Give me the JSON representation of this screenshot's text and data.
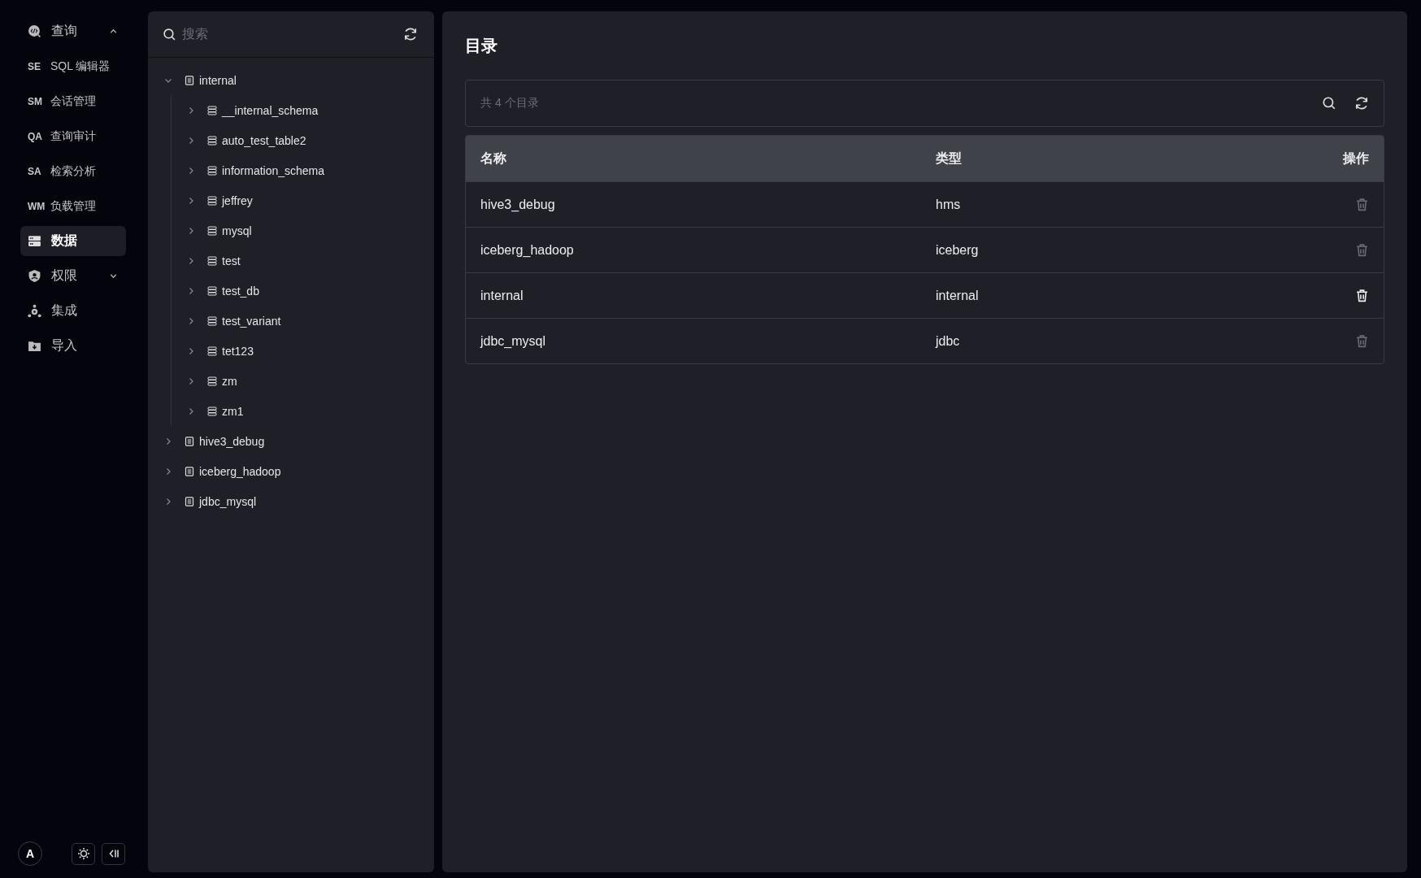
{
  "sidebar": {
    "items": [
      {
        "kind": "group",
        "label": "查询",
        "expanded": true,
        "selected": false
      },
      {
        "kind": "sub",
        "abbr": "SE",
        "label": "SQL 编辑器",
        "selected": false
      },
      {
        "kind": "sub",
        "abbr": "SM",
        "label": "会话管理",
        "selected": false
      },
      {
        "kind": "sub",
        "abbr": "QA",
        "label": "查询审计",
        "selected": false
      },
      {
        "kind": "sub",
        "abbr": "SA",
        "label": "检索分析",
        "selected": false
      },
      {
        "kind": "sub",
        "abbr": "WM",
        "label": "负载管理",
        "selected": false
      },
      {
        "kind": "item",
        "label": "数据",
        "selected": true
      },
      {
        "kind": "group",
        "label": "权限",
        "expanded": false,
        "selected": false
      },
      {
        "kind": "item",
        "label": "集成",
        "selected": false
      },
      {
        "kind": "item",
        "label": "导入",
        "selected": false
      }
    ],
    "avatar": "A"
  },
  "tree": {
    "search": {
      "placeholder": "搜索"
    },
    "nodes": [
      {
        "kind": "catalog",
        "label": "internal",
        "expanded": true,
        "children": [
          {
            "kind": "database",
            "label": "__internal_schema",
            "expanded": false
          },
          {
            "kind": "database",
            "label": "auto_test_table2",
            "expanded": false
          },
          {
            "kind": "database",
            "label": "information_schema",
            "expanded": false
          },
          {
            "kind": "database",
            "label": "jeffrey",
            "expanded": false
          },
          {
            "kind": "database",
            "label": "mysql",
            "expanded": false
          },
          {
            "kind": "database",
            "label": "test",
            "expanded": false
          },
          {
            "kind": "database",
            "label": "test_db",
            "expanded": false
          },
          {
            "kind": "database",
            "label": "test_variant",
            "expanded": false
          },
          {
            "kind": "database",
            "label": "tet123",
            "expanded": false
          },
          {
            "kind": "database",
            "label": "zm",
            "expanded": false
          },
          {
            "kind": "database",
            "label": "zm1",
            "expanded": false
          }
        ]
      },
      {
        "kind": "catalog",
        "label": "hive3_debug",
        "expanded": false
      },
      {
        "kind": "catalog",
        "label": "iceberg_hadoop",
        "expanded": false
      },
      {
        "kind": "catalog",
        "label": "jdbc_mysql",
        "expanded": false
      }
    ]
  },
  "main": {
    "title": "目录",
    "summary": "共 4 个目录",
    "table": {
      "columns": [
        "名称",
        "类型",
        "操作"
      ],
      "rows": [
        {
          "name": "hive3_debug",
          "type": "hms",
          "delete_disabled": true
        },
        {
          "name": "iceberg_hadoop",
          "type": "iceberg",
          "delete_disabled": true
        },
        {
          "name": "internal",
          "type": "internal",
          "delete_disabled": false
        },
        {
          "name": "jdbc_mysql",
          "type": "jdbc",
          "delete_disabled": true
        }
      ]
    }
  }
}
